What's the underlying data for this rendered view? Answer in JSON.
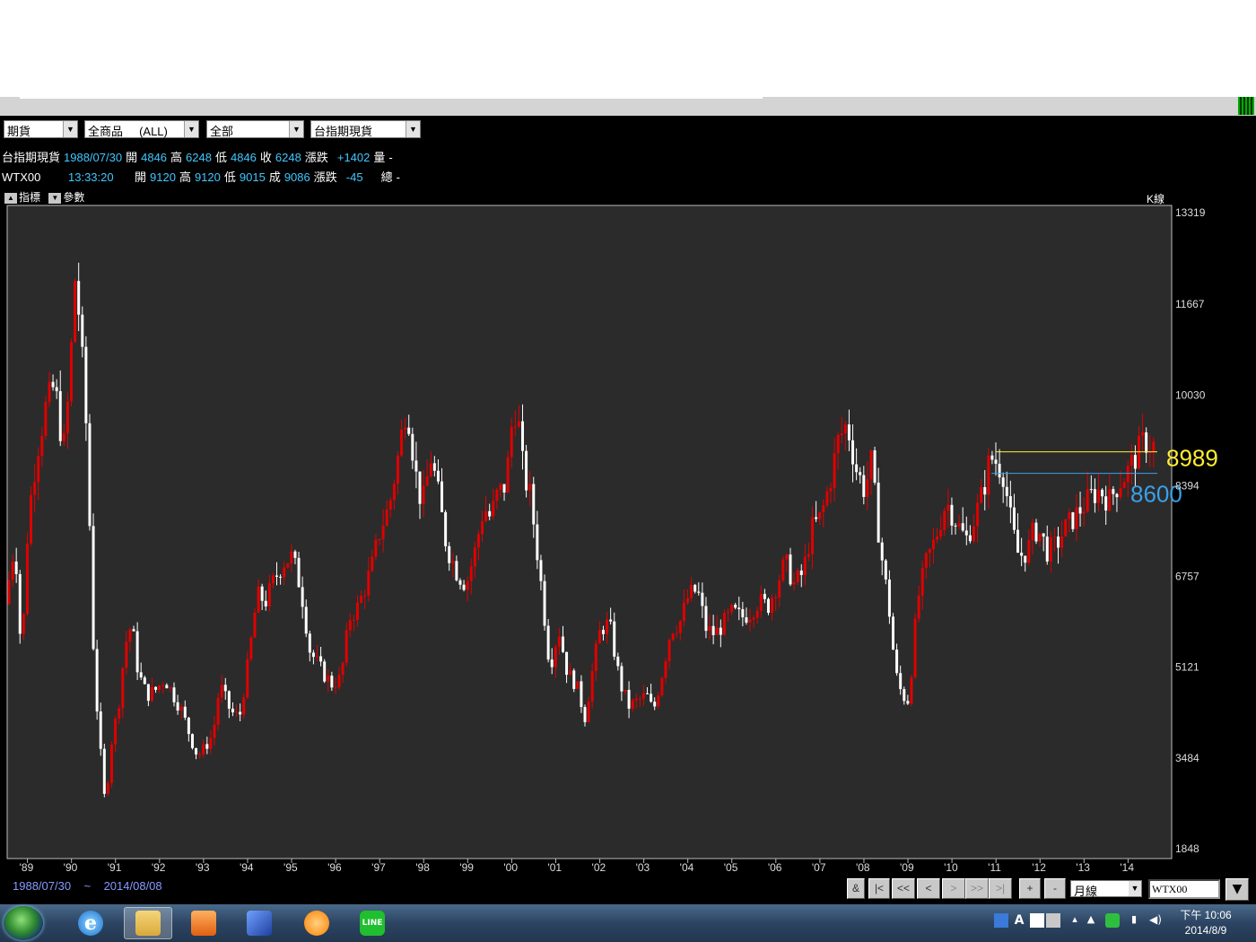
{
  "filters": {
    "market": "期貨",
    "product": "全商品",
    "product_scope": "(ALL)",
    "group": "全部",
    "contract": "台指期現貨"
  },
  "quote_rows": [
    {
      "name": "台指期現貨",
      "time": "1988/07/30",
      "open_label": "開",
      "open": "4846",
      "high_label": "高",
      "high": "6248",
      "low_label": "低",
      "low": "4846",
      "close_label": "收",
      "close": "6248",
      "change_label": "漲跌",
      "change": "+1402",
      "volume_label": "量",
      "volume": "-"
    },
    {
      "name": "WTX00",
      "time": "13:33:20",
      "open_label": "開",
      "open": "9120",
      "high_label": "高",
      "high": "9120",
      "low_label": "低",
      "low": "9015",
      "close_label": "成",
      "close": "9086",
      "change_label": "漲跌",
      "change": "-45",
      "volume_label": "總",
      "volume": "-"
    }
  ],
  "tabs": {
    "indicator": "指標",
    "params": "參數",
    "kline": "K線"
  },
  "range": {
    "start": "1988/07/30",
    "sep": "~",
    "end": "2014/08/08"
  },
  "nav_buttons": [
    "&",
    "|<",
    "<<",
    "<",
    ">",
    ">>",
    ">|",
    "+",
    "-"
  ],
  "period": "月線",
  "symbol": "WTX00",
  "clock": {
    "time": "下午 10:06",
    "date": "2014/8/9"
  },
  "taskbar_apps": [
    "internet-explorer-icon",
    "file-explorer-icon",
    "media-player-icon",
    "trading-app-icon",
    "orange-app-icon",
    "line-icon"
  ],
  "colors": {
    "up": "#e00000",
    "down": "#ffffff",
    "line1": "#ffee33",
    "line2": "#3aa0e8",
    "panel": "#2b2b2b"
  },
  "chart_data": {
    "type": "candlestick",
    "frequency": "monthly",
    "y_ticks": [
      13319,
      11667,
      10030,
      8394,
      6757,
      5121,
      3484,
      1848
    ],
    "ylim": [
      1848,
      13319
    ],
    "x_labels": [
      "'89",
      "'90",
      "'91",
      "'92",
      "'93",
      "'94",
      "'95",
      "'96",
      "'97",
      "'98",
      "'99",
      "'00",
      "'01",
      "'02",
      "'03",
      "'04",
      "'05",
      "'06",
      "'07",
      "'08",
      "'09",
      "'10",
      "'11",
      "'12",
      "'13",
      "'14"
    ],
    "x_years": [
      1989,
      1990,
      1991,
      1992,
      1993,
      1994,
      1995,
      1996,
      1997,
      1998,
      1999,
      2000,
      2001,
      2002,
      2003,
      2004,
      2005,
      2006,
      2007,
      2008,
      2009,
      2010,
      2011,
      2012,
      2013,
      2014
    ],
    "x_start": 1988.58,
    "x_end": 2014.95,
    "close_path": [
      [
        1988.58,
        6248
      ],
      [
        1988.8,
        7400
      ],
      [
        1988.95,
        5200
      ],
      [
        1989.1,
        7800
      ],
      [
        1989.3,
        9000
      ],
      [
        1989.5,
        9800
      ],
      [
        1989.7,
        10200
      ],
      [
        1989.9,
        9000
      ],
      [
        1990.05,
        10300
      ],
      [
        1990.15,
        12200
      ],
      [
        1990.25,
        11500
      ],
      [
        1990.4,
        9800
      ],
      [
        1990.5,
        7600
      ],
      [
        1990.6,
        5000
      ],
      [
        1990.75,
        3500
      ],
      [
        1990.85,
        2600
      ],
      [
        1991.0,
        3800
      ],
      [
        1991.15,
        4400
      ],
      [
        1991.3,
        5500
      ],
      [
        1991.45,
        5900
      ],
      [
        1991.6,
        5000
      ],
      [
        1991.8,
        4600
      ],
      [
        1992.0,
        4700
      ],
      [
        1992.2,
        4900
      ],
      [
        1992.4,
        4600
      ],
      [
        1992.6,
        4300
      ],
      [
        1992.8,
        3800
      ],
      [
        1992.95,
        3500
      ],
      [
        1993.15,
        3700
      ],
      [
        1993.3,
        3900
      ],
      [
        1993.45,
        4800
      ],
      [
        1993.7,
        4300
      ],
      [
        1993.9,
        4200
      ],
      [
        1994.1,
        5200
      ],
      [
        1994.3,
        6400
      ],
      [
        1994.5,
        6300
      ],
      [
        1994.7,
        6700
      ],
      [
        1994.9,
        7000
      ],
      [
        1995.1,
        7100
      ],
      [
        1995.3,
        6500
      ],
      [
        1995.5,
        5400
      ],
      [
        1995.8,
        5000
      ],
      [
        1996.0,
        4800
      ],
      [
        1996.2,
        4900
      ],
      [
        1996.4,
        6000
      ],
      [
        1996.6,
        6200
      ],
      [
        1996.9,
        6900
      ],
      [
        1997.1,
        7600
      ],
      [
        1997.3,
        8000
      ],
      [
        1997.5,
        8900
      ],
      [
        1997.7,
        9900
      ],
      [
        1997.9,
        8600
      ],
      [
        1998.05,
        8000
      ],
      [
        1998.25,
        8900
      ],
      [
        1998.4,
        8300
      ],
      [
        1998.6,
        7300
      ],
      [
        1998.85,
        6800
      ],
      [
        1999.05,
        6600
      ],
      [
        1999.25,
        7200
      ],
      [
        1999.45,
        8000
      ],
      [
        1999.6,
        7800
      ],
      [
        1999.75,
        8200
      ],
      [
        1999.95,
        8400
      ],
      [
        2000.1,
        9600
      ],
      [
        2000.2,
        9800
      ],
      [
        2000.35,
        8600
      ],
      [
        2000.5,
        8200
      ],
      [
        2000.6,
        7600
      ],
      [
        2000.75,
        6600
      ],
      [
        2000.95,
        5100
      ],
      [
        2001.15,
        5800
      ],
      [
        2001.35,
        5000
      ],
      [
        2001.55,
        4800
      ],
      [
        2001.75,
        4200
      ],
      [
        2001.95,
        5200
      ],
      [
        2002.1,
        5800
      ],
      [
        2002.3,
        5900
      ],
      [
        2002.55,
        4800
      ],
      [
        2002.75,
        4400
      ],
      [
        2002.95,
        4500
      ],
      [
        2003.15,
        4600
      ],
      [
        2003.3,
        4300
      ],
      [
        2003.5,
        5000
      ],
      [
        2003.7,
        5800
      ],
      [
        2003.9,
        5900
      ],
      [
        2004.1,
        6400
      ],
      [
        2004.3,
        6500
      ],
      [
        2004.5,
        5800
      ],
      [
        2004.7,
        5700
      ],
      [
        2004.9,
        5900
      ],
      [
        2005.1,
        6100
      ],
      [
        2005.3,
        6000
      ],
      [
        2005.5,
        6100
      ],
      [
        2005.7,
        6300
      ],
      [
        2005.9,
        6200
      ],
      [
        2006.1,
        6600
      ],
      [
        2006.3,
        7000
      ],
      [
        2006.5,
        6600
      ],
      [
        2006.7,
        6800
      ],
      [
        2006.9,
        7600
      ],
      [
        2007.1,
        7800
      ],
      [
        2007.3,
        8400
      ],
      [
        2007.5,
        9200
      ],
      [
        2007.7,
        9500
      ],
      [
        2007.9,
        8700
      ],
      [
        2008.1,
        8300
      ],
      [
        2008.25,
        8800
      ],
      [
        2008.45,
        7300
      ],
      [
        2008.65,
        6200
      ],
      [
        2008.8,
        5000
      ],
      [
        2008.95,
        4600
      ],
      [
        2009.1,
        4500
      ],
      [
        2009.3,
        6300
      ],
      [
        2009.5,
        7000
      ],
      [
        2009.7,
        7400
      ],
      [
        2009.95,
        8100
      ],
      [
        2010.2,
        7700
      ],
      [
        2010.4,
        7400
      ],
      [
        2010.6,
        7800
      ],
      [
        2010.8,
        8300
      ],
      [
        2010.95,
        8900
      ],
      [
        2011.1,
        8800
      ],
      [
        2011.25,
        8600
      ],
      [
        2011.45,
        7600
      ],
      [
        2011.6,
        7100
      ],
      [
        2011.8,
        7200
      ],
      [
        2011.95,
        7600
      ],
      [
        2012.1,
        7500
      ],
      [
        2012.25,
        7200
      ],
      [
        2012.45,
        7300
      ],
      [
        2012.65,
        7600
      ],
      [
        2012.85,
        7800
      ],
      [
        2013.05,
        8000
      ],
      [
        2013.25,
        8200
      ],
      [
        2013.45,
        8300
      ],
      [
        2013.65,
        8100
      ],
      [
        2013.85,
        8400
      ],
      [
        2014.05,
        8600
      ],
      [
        2014.25,
        8900
      ],
      [
        2014.45,
        9200
      ],
      [
        2014.6,
        9100
      ]
    ],
    "levels": [
      {
        "value": 8989,
        "label": "8989",
        "color": "#ffee33",
        "x_from": 2011.0
      },
      {
        "value": 8600,
        "label": "8600",
        "color": "#3aa0e8",
        "x_from": 2010.9
      }
    ]
  }
}
